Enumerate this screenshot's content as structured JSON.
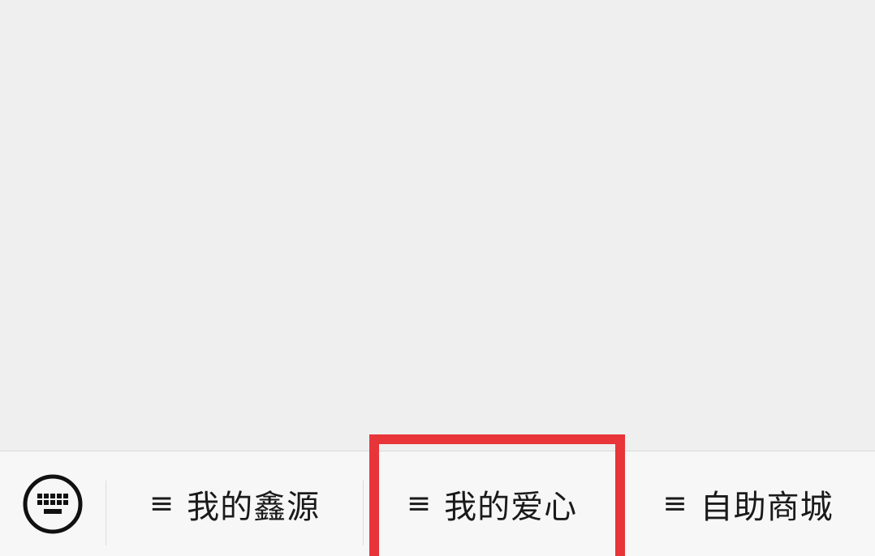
{
  "menu": {
    "items": [
      {
        "icon": "≡",
        "label": "我的鑫源"
      },
      {
        "icon": "≡",
        "label": "我的爱心"
      },
      {
        "icon": "≡",
        "label": "自助商城"
      }
    ]
  },
  "colors": {
    "chat_background": "#efefef",
    "menu_background": "#f7f7f7",
    "highlight": "#e8353a",
    "text": "#1a1a1a"
  }
}
